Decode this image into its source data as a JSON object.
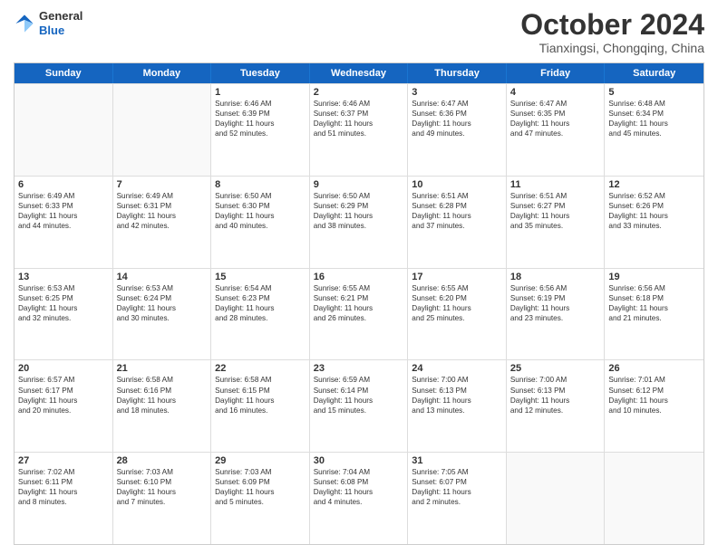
{
  "logo": {
    "general": "General",
    "blue": "Blue"
  },
  "header": {
    "month": "October 2024",
    "location": "Tianxingsi, Chongqing, China"
  },
  "weekdays": [
    "Sunday",
    "Monday",
    "Tuesday",
    "Wednesday",
    "Thursday",
    "Friday",
    "Saturday"
  ],
  "weeks": [
    [
      {
        "day": "",
        "lines": []
      },
      {
        "day": "",
        "lines": []
      },
      {
        "day": "1",
        "lines": [
          "Sunrise: 6:46 AM",
          "Sunset: 6:39 PM",
          "Daylight: 11 hours",
          "and 52 minutes."
        ]
      },
      {
        "day": "2",
        "lines": [
          "Sunrise: 6:46 AM",
          "Sunset: 6:37 PM",
          "Daylight: 11 hours",
          "and 51 minutes."
        ]
      },
      {
        "day": "3",
        "lines": [
          "Sunrise: 6:47 AM",
          "Sunset: 6:36 PM",
          "Daylight: 11 hours",
          "and 49 minutes."
        ]
      },
      {
        "day": "4",
        "lines": [
          "Sunrise: 6:47 AM",
          "Sunset: 6:35 PM",
          "Daylight: 11 hours",
          "and 47 minutes."
        ]
      },
      {
        "day": "5",
        "lines": [
          "Sunrise: 6:48 AM",
          "Sunset: 6:34 PM",
          "Daylight: 11 hours",
          "and 45 minutes."
        ]
      }
    ],
    [
      {
        "day": "6",
        "lines": [
          "Sunrise: 6:49 AM",
          "Sunset: 6:33 PM",
          "Daylight: 11 hours",
          "and 44 minutes."
        ]
      },
      {
        "day": "7",
        "lines": [
          "Sunrise: 6:49 AM",
          "Sunset: 6:31 PM",
          "Daylight: 11 hours",
          "and 42 minutes."
        ]
      },
      {
        "day": "8",
        "lines": [
          "Sunrise: 6:50 AM",
          "Sunset: 6:30 PM",
          "Daylight: 11 hours",
          "and 40 minutes."
        ]
      },
      {
        "day": "9",
        "lines": [
          "Sunrise: 6:50 AM",
          "Sunset: 6:29 PM",
          "Daylight: 11 hours",
          "and 38 minutes."
        ]
      },
      {
        "day": "10",
        "lines": [
          "Sunrise: 6:51 AM",
          "Sunset: 6:28 PM",
          "Daylight: 11 hours",
          "and 37 minutes."
        ]
      },
      {
        "day": "11",
        "lines": [
          "Sunrise: 6:51 AM",
          "Sunset: 6:27 PM",
          "Daylight: 11 hours",
          "and 35 minutes."
        ]
      },
      {
        "day": "12",
        "lines": [
          "Sunrise: 6:52 AM",
          "Sunset: 6:26 PM",
          "Daylight: 11 hours",
          "and 33 minutes."
        ]
      }
    ],
    [
      {
        "day": "13",
        "lines": [
          "Sunrise: 6:53 AM",
          "Sunset: 6:25 PM",
          "Daylight: 11 hours",
          "and 32 minutes."
        ]
      },
      {
        "day": "14",
        "lines": [
          "Sunrise: 6:53 AM",
          "Sunset: 6:24 PM",
          "Daylight: 11 hours",
          "and 30 minutes."
        ]
      },
      {
        "day": "15",
        "lines": [
          "Sunrise: 6:54 AM",
          "Sunset: 6:23 PM",
          "Daylight: 11 hours",
          "and 28 minutes."
        ]
      },
      {
        "day": "16",
        "lines": [
          "Sunrise: 6:55 AM",
          "Sunset: 6:21 PM",
          "Daylight: 11 hours",
          "and 26 minutes."
        ]
      },
      {
        "day": "17",
        "lines": [
          "Sunrise: 6:55 AM",
          "Sunset: 6:20 PM",
          "Daylight: 11 hours",
          "and 25 minutes."
        ]
      },
      {
        "day": "18",
        "lines": [
          "Sunrise: 6:56 AM",
          "Sunset: 6:19 PM",
          "Daylight: 11 hours",
          "and 23 minutes."
        ]
      },
      {
        "day": "19",
        "lines": [
          "Sunrise: 6:56 AM",
          "Sunset: 6:18 PM",
          "Daylight: 11 hours",
          "and 21 minutes."
        ]
      }
    ],
    [
      {
        "day": "20",
        "lines": [
          "Sunrise: 6:57 AM",
          "Sunset: 6:17 PM",
          "Daylight: 11 hours",
          "and 20 minutes."
        ]
      },
      {
        "day": "21",
        "lines": [
          "Sunrise: 6:58 AM",
          "Sunset: 6:16 PM",
          "Daylight: 11 hours",
          "and 18 minutes."
        ]
      },
      {
        "day": "22",
        "lines": [
          "Sunrise: 6:58 AM",
          "Sunset: 6:15 PM",
          "Daylight: 11 hours",
          "and 16 minutes."
        ]
      },
      {
        "day": "23",
        "lines": [
          "Sunrise: 6:59 AM",
          "Sunset: 6:14 PM",
          "Daylight: 11 hours",
          "and 15 minutes."
        ]
      },
      {
        "day": "24",
        "lines": [
          "Sunrise: 7:00 AM",
          "Sunset: 6:13 PM",
          "Daylight: 11 hours",
          "and 13 minutes."
        ]
      },
      {
        "day": "25",
        "lines": [
          "Sunrise: 7:00 AM",
          "Sunset: 6:13 PM",
          "Daylight: 11 hours",
          "and 12 minutes."
        ]
      },
      {
        "day": "26",
        "lines": [
          "Sunrise: 7:01 AM",
          "Sunset: 6:12 PM",
          "Daylight: 11 hours",
          "and 10 minutes."
        ]
      }
    ],
    [
      {
        "day": "27",
        "lines": [
          "Sunrise: 7:02 AM",
          "Sunset: 6:11 PM",
          "Daylight: 11 hours",
          "and 8 minutes."
        ]
      },
      {
        "day": "28",
        "lines": [
          "Sunrise: 7:03 AM",
          "Sunset: 6:10 PM",
          "Daylight: 11 hours",
          "and 7 minutes."
        ]
      },
      {
        "day": "29",
        "lines": [
          "Sunrise: 7:03 AM",
          "Sunset: 6:09 PM",
          "Daylight: 11 hours",
          "and 5 minutes."
        ]
      },
      {
        "day": "30",
        "lines": [
          "Sunrise: 7:04 AM",
          "Sunset: 6:08 PM",
          "Daylight: 11 hours",
          "and 4 minutes."
        ]
      },
      {
        "day": "31",
        "lines": [
          "Sunrise: 7:05 AM",
          "Sunset: 6:07 PM",
          "Daylight: 11 hours",
          "and 2 minutes."
        ]
      },
      {
        "day": "",
        "lines": []
      },
      {
        "day": "",
        "lines": []
      }
    ]
  ]
}
